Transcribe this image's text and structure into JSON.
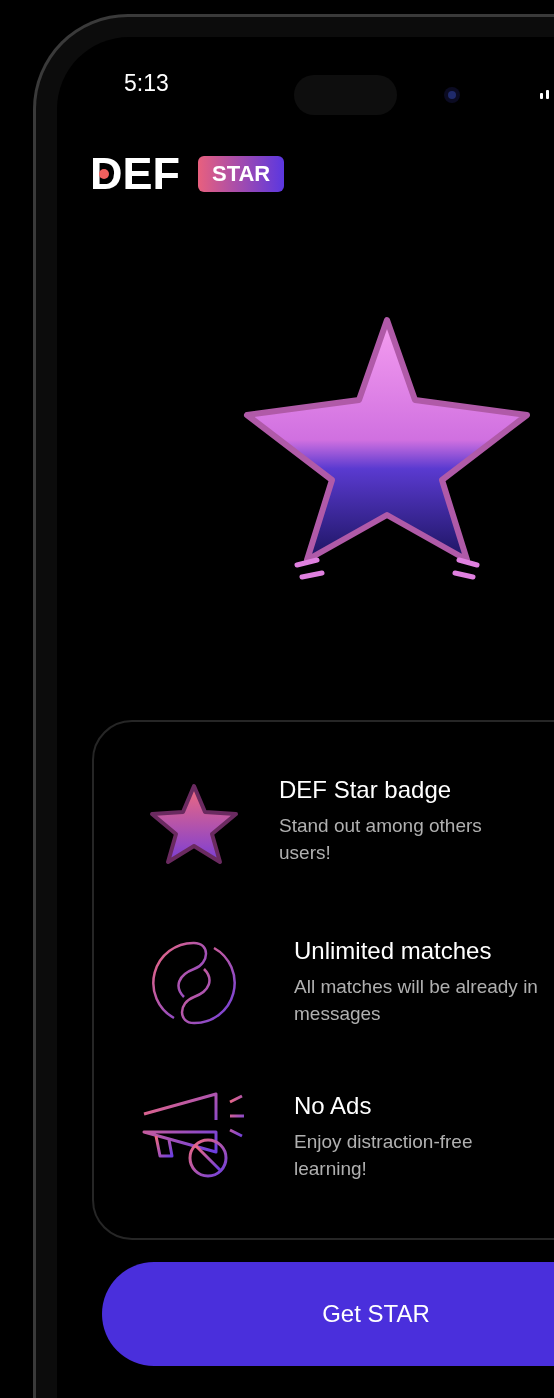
{
  "status_bar": {
    "time": "5:13"
  },
  "header": {
    "logo": "DEF",
    "badge": "STAR"
  },
  "features": [
    {
      "kind": "star",
      "title": "DEF Star badge",
      "description": "Stand out among others users!"
    },
    {
      "kind": "matches",
      "title": "Unlimited matches",
      "description": "All matches will be already in messages"
    },
    {
      "kind": "no_ads",
      "title": "No Ads",
      "description": "Enjoy distraction-free learning!"
    }
  ],
  "button": "Get STAR"
}
